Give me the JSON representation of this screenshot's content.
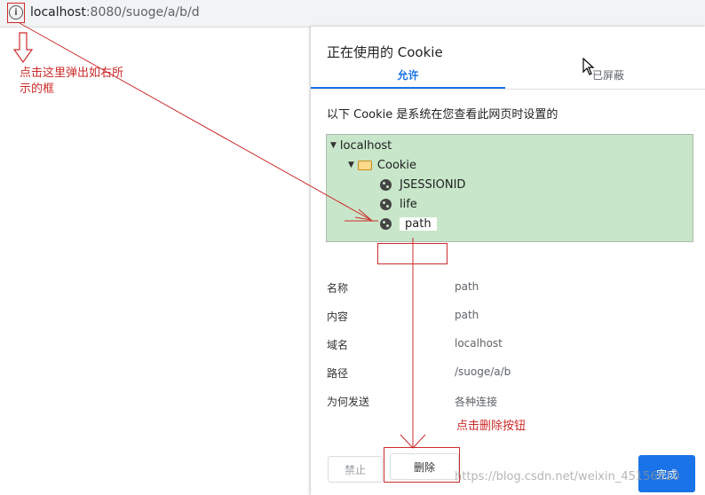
{
  "address_bar": {
    "host": "localhost",
    "rest": ":8080/suoge/a/b/d",
    "info_icon": "i"
  },
  "dialog": {
    "title": "正在使用的 Cookie",
    "tabs": [
      {
        "label": "允许",
        "active": true
      },
      {
        "label": "已屏蔽",
        "active": false
      }
    ],
    "description": "以下 Cookie 是系统在您查看此网页时设置的",
    "tree": {
      "root": "localhost",
      "folder": "Cookie",
      "cookies": [
        "JSESSIONID",
        "life",
        "path"
      ],
      "selected": "path"
    },
    "details": [
      {
        "label": "名称",
        "value": "path"
      },
      {
        "label": "内容",
        "value": "path"
      },
      {
        "label": "域名",
        "value": "localhost"
      },
      {
        "label": "路径",
        "value": "/suoge/a/b"
      },
      {
        "label": "为何发送",
        "value": "各种连接"
      }
    ],
    "buttons": {
      "block": "禁止",
      "delete": "删除",
      "done": "完成"
    }
  },
  "annotations": {
    "click_here_line1": "点击这里弹出如右所",
    "click_here_line2": "示的框",
    "click_delete": "点击删除按钮"
  },
  "watermark": "https://blog.csdn.net/weixin_45156610",
  "colors": {
    "annotation_red": "#cc2b2b",
    "tree_bg": "#c8e6c9",
    "accent_blue": "#1a73e8"
  }
}
